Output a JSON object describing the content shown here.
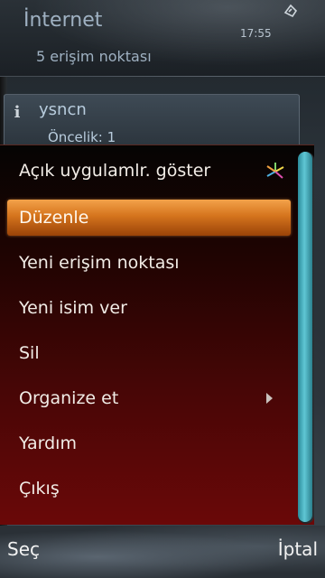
{
  "header": {
    "title": "İnternet",
    "subtitle": "5 erişim noktası",
    "clock": "17:55",
    "signal_icon": "signal-icon"
  },
  "list": {
    "items": [
      {
        "name": "ysncn",
        "priority": "Öncelik: 1",
        "icon": "info-icon"
      }
    ]
  },
  "menu": {
    "items": [
      {
        "label": "Açık uygulamlr. göster",
        "icon": "multitask-icon"
      },
      {
        "label": "Düzenle",
        "selected": true
      },
      {
        "label": "Yeni erişim noktası"
      },
      {
        "label": "Yeni isim ver"
      },
      {
        "label": "Sil"
      },
      {
        "label": "Organize et",
        "has_submenu": true
      },
      {
        "label": "Yardım"
      },
      {
        "label": "Çıkış"
      }
    ]
  },
  "softkeys": {
    "left": "Seç",
    "right": "İptal"
  },
  "colors": {
    "highlight": "#e07f22",
    "scrollbar": "#4fb6c4",
    "menu_bottom": "#6a0808"
  }
}
